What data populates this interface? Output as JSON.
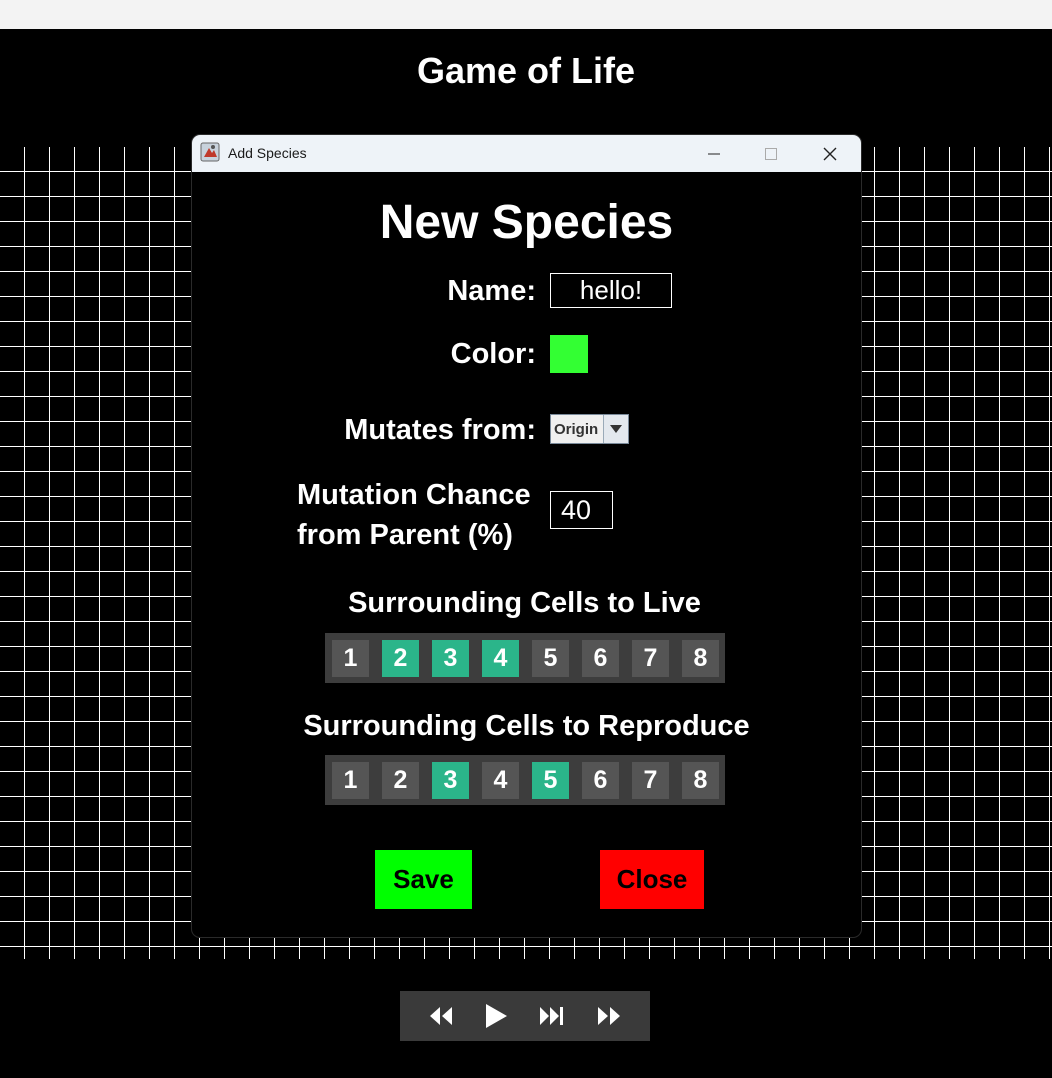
{
  "app": {
    "title": "Game of Life"
  },
  "controls": {
    "icons": [
      "rewind-icon",
      "play-icon",
      "step-forward-icon",
      "fast-forward-icon"
    ]
  },
  "dialog": {
    "window_title": "Add Species",
    "heading": "New Species",
    "name_label": "Name:",
    "name_value": "hello!",
    "color_label": "Color:",
    "color_value": "#33ff33",
    "mutates_label": "Mutates from:",
    "mutates_value": "Origin",
    "chance_label_line1": "Mutation Chance",
    "chance_label_line2": "from Parent (%)",
    "chance_value": "40",
    "live_title": "Surrounding Cells to Live",
    "live_cells": [
      {
        "label": "1",
        "on": false
      },
      {
        "label": "2",
        "on": true
      },
      {
        "label": "3",
        "on": true
      },
      {
        "label": "4",
        "on": true
      },
      {
        "label": "5",
        "on": false
      },
      {
        "label": "6",
        "on": false
      },
      {
        "label": "7",
        "on": false
      },
      {
        "label": "8",
        "on": false
      }
    ],
    "reproduce_title": "Surrounding Cells to Reproduce",
    "reproduce_cells": [
      {
        "label": "1",
        "on": false
      },
      {
        "label": "2",
        "on": false
      },
      {
        "label": "3",
        "on": true
      },
      {
        "label": "4",
        "on": false
      },
      {
        "label": "5",
        "on": true
      },
      {
        "label": "6",
        "on": false
      },
      {
        "label": "7",
        "on": false
      },
      {
        "label": "8",
        "on": false
      }
    ],
    "save_label": "Save",
    "close_label": "Close"
  },
  "colors": {
    "active_cell": "#2bb58a",
    "inactive_cell": "#555555",
    "save": "#00ff00",
    "close": "#ff0000"
  }
}
